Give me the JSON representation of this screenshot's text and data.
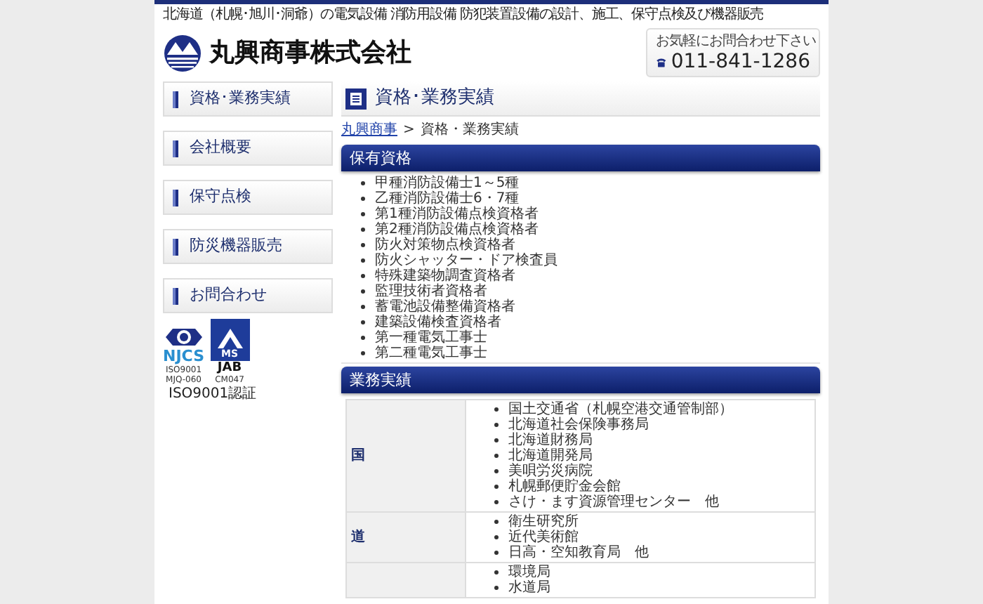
{
  "header": {
    "tagline": "北海道（札幌･旭川･洞爺）の電気設備 消防用設備 防犯装置設備の設計、施工、保守点検及び機器販売",
    "company_name": "丸興商事株式会社",
    "contact": {
      "prompt": "お気軽にお問合わせ下さい",
      "phone": "011-841-1286"
    }
  },
  "sidebar": {
    "items": [
      {
        "label": "資格･業務実績"
      },
      {
        "label": "会社概要"
      },
      {
        "label": "保守点検"
      },
      {
        "label": "防災機器販売"
      },
      {
        "label": "お問合わせ"
      }
    ],
    "certification": {
      "njcs_label": "NJCS",
      "njcs_standard": "ISO9001",
      "njcs_code": "MJQ-060",
      "jab_ms": "MS",
      "jab_label": "JAB",
      "jab_code": "CM047",
      "caption": "ISO9001認証"
    }
  },
  "main": {
    "title": "資格･業務実績",
    "breadcrumb": {
      "link": "丸興商事",
      "separator": ">",
      "current": "資格・業務実績"
    },
    "qualifications": {
      "heading": "保有資格",
      "items": [
        "甲種消防設備士1～5種",
        "乙種消防設備士6・7種",
        "第1種消防設備点検資格者",
        "第2種消防設備点検資格者",
        "防火対策物点検資格者",
        "防火シャッター・ドア検査員",
        "特殊建築物調査資格者",
        "監理技術者資格者",
        "蓄電池設備整備資格者",
        "建築設備検査資格者",
        "第一種電気工事士",
        "第二種電気工事士"
      ]
    },
    "track_record": {
      "heading": "業務実績",
      "rows": [
        {
          "category": "国",
          "items": [
            "国土交通省（札幌空港交通管制部）",
            "北海道社会保険事務局",
            "北海道財務局",
            "北海道開発局",
            "美唄労災病院",
            "札幌郵便貯金会館",
            "さけ・ます資源管理センター　他"
          ]
        },
        {
          "category": "道",
          "items": [
            "衛生研究所",
            "近代美術館",
            "日高・空知教育局　他"
          ]
        },
        {
          "category": "",
          "items": [
            "環境局",
            "水道局"
          ]
        }
      ]
    }
  }
}
